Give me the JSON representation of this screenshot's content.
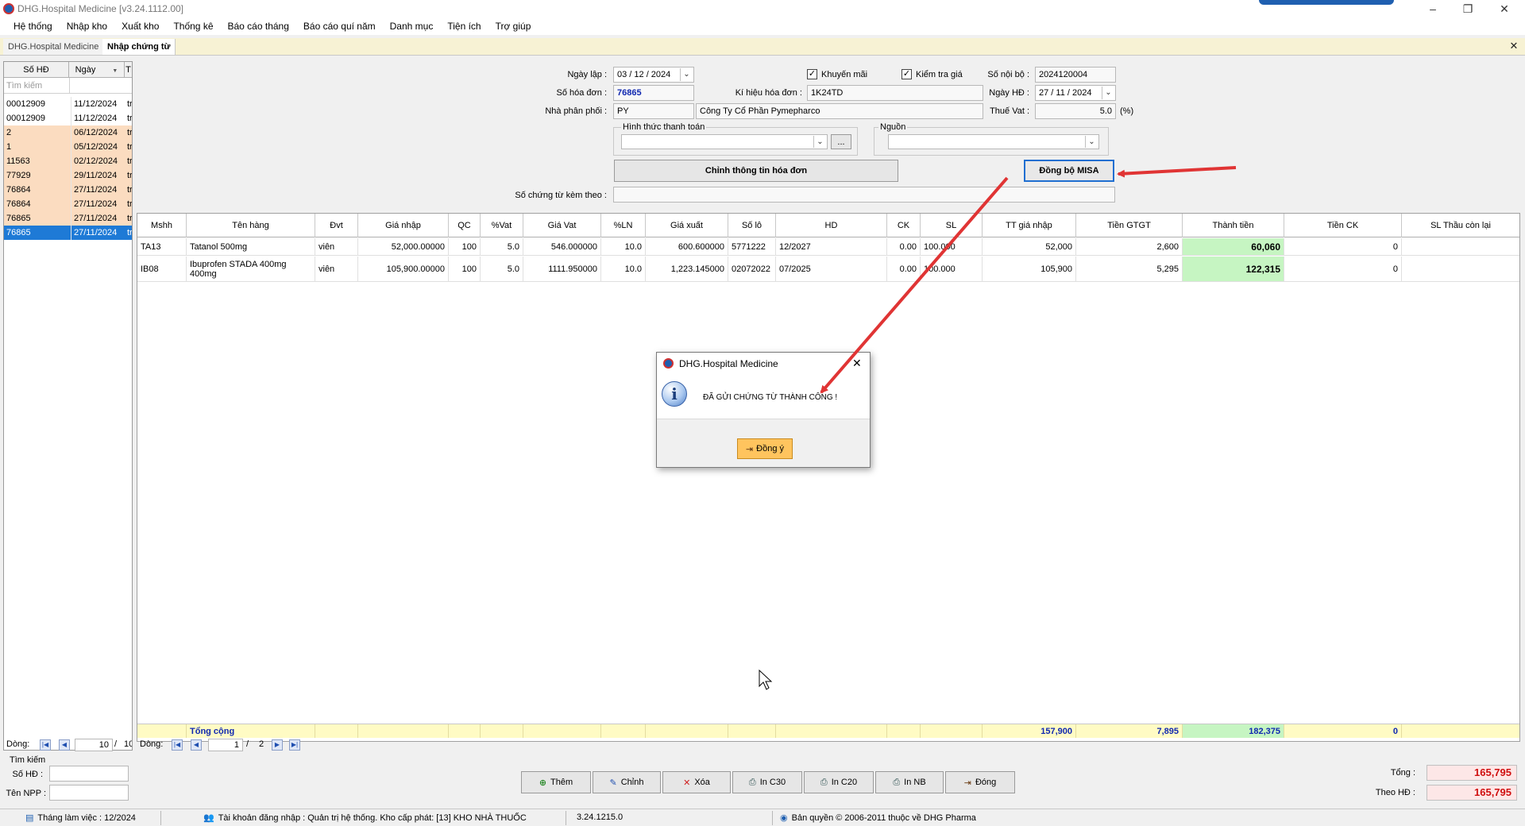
{
  "window": {
    "title": "DHG.Hospital Medicine [v3.24.1112.00]",
    "controls": [
      "–",
      "❐",
      "✕"
    ]
  },
  "menu": [
    "Hệ thống",
    "Nhập kho",
    "Xuất kho",
    "Thống kê",
    "Báo cáo tháng",
    "Báo cáo quí năm",
    "Danh mục",
    "Tiện ích",
    "Trợ giúp"
  ],
  "tabs": {
    "inactive": "DHG.Hospital Medicine",
    "active": "Nhập chứng từ",
    "close": "✕"
  },
  "left_list": {
    "headers": [
      "Số HĐ",
      "Ngày",
      "T"
    ],
    "search_placeholder": "Tìm kiếm",
    "rows": [
      {
        "so": "00012909",
        "ngay": "11/12/2024",
        "t": "tr",
        "style": "white"
      },
      {
        "so": "00012909",
        "ngay": "11/12/2024",
        "t": "tr",
        "style": "white"
      },
      {
        "so": "2",
        "ngay": "06/12/2024",
        "t": "tr",
        "style": "peach"
      },
      {
        "so": "1",
        "ngay": "05/12/2024",
        "t": "tr",
        "style": "peach"
      },
      {
        "so": "11563",
        "ngay": "02/12/2024",
        "t": "tr",
        "style": "peach"
      },
      {
        "so": "77929",
        "ngay": "29/11/2024",
        "t": "tr",
        "style": "peach"
      },
      {
        "so": "76864",
        "ngay": "27/11/2024",
        "t": "tr",
        "style": "peach"
      },
      {
        "so": "76864",
        "ngay": "27/11/2024",
        "t": "tr",
        "style": "peach"
      },
      {
        "so": "76865",
        "ngay": "27/11/2024",
        "t": "tr",
        "style": "peach"
      },
      {
        "so": "76865",
        "ngay": "27/11/2024",
        "t": "tr",
        "style": "sel"
      }
    ],
    "nav_label": "Dòng:",
    "nav_current": "10",
    "nav_sep": "/",
    "nav_total": "10"
  },
  "form": {
    "ngay_lap_label": "Ngày lập :",
    "ngay_lap_value": "03 / 12 / 2024",
    "so_hoa_don_label": "Số hóa đơn :",
    "so_hoa_don_value": "76865",
    "nha_phan_phoi_label": "Nhà phân phối :",
    "nha_phan_phoi_code": "PY",
    "nha_phan_phoi_name": "Công Ty Cổ Phần Pymepharco",
    "khuyen_mai_label": "Khuyến mãi",
    "khuyen_mai_checked": "✓",
    "kiem_tra_gia_label": "Kiểm tra giá",
    "kiem_tra_gia_checked": "✓",
    "ki_hieu_label": "Kí hiệu hóa đơn :",
    "ki_hieu_value": "1K24TD",
    "so_noi_bo_label": "Số nội bộ :",
    "so_noi_bo_value": "2024120004",
    "ngay_hd_label": "Ngày HĐ :",
    "ngay_hd_value": "27 / 11 / 2024",
    "thue_vat_label": "Thuế Vat :",
    "thue_vat_value": "5.0",
    "thue_vat_unit": "(%)",
    "hinh_thuc_label": "Hình thức thanh toán",
    "ellipsis": "...",
    "nguon_label": "Nguồn",
    "chinh_thong_tin_btn": "Chỉnh thông tin hóa đơn",
    "dong_bo_btn": "Đồng bộ MISA",
    "so_chung_tu_label": "Số chứng từ kèm theo :"
  },
  "grid": {
    "headers": [
      "Mshh",
      "Tên hàng",
      "Đvt",
      "Giá nhập",
      "QC",
      "%Vat",
      "Giá Vat",
      "%LN",
      "Giá xuất",
      "Số lô",
      "HD",
      "CK",
      "SL",
      "TT giá nhập",
      "Tiền GTGT",
      "Thành tiền",
      "Tiền CK",
      "SL Thầu còn lại"
    ],
    "rows": [
      [
        "TA13",
        "Tatanol 500mg",
        "viên",
        "52,000.00000",
        "100",
        "5.0",
        "546.000000",
        "10.0",
        "600.600000",
        "5771222",
        "12/2027",
        "0.00",
        "100.000",
        "52,000",
        "2,600",
        "60,060",
        "0",
        ""
      ],
      [
        "IB08",
        "Ibuprofen STADA 400mg 400mg",
        "viên",
        "105,900.00000",
        "100",
        "5.0",
        "1111.950000",
        "10.0",
        "1,223.145000",
        "02072022",
        "07/2025",
        "0.00",
        "100.000",
        "105,900",
        "5,295",
        "122,315",
        "0",
        ""
      ]
    ],
    "total_label": "Tổng cộng",
    "total_tt_gia_nhap": "157,900",
    "total_tien_gtgt": "7,895",
    "total_thanh_tien": "182,375",
    "total_tien_ck": "0",
    "nav_label": "Dòng:",
    "nav_current": "1",
    "nav_sep": "/",
    "nav_total": "2"
  },
  "search_panel": {
    "title": "Tìm kiếm",
    "so_hd_label": "Số HĐ :",
    "ten_npp_label": "Tên NPP :"
  },
  "actions": [
    "Thêm",
    "Chỉnh",
    "Xóa",
    "In C30",
    "In C20",
    "In NB",
    "Đóng"
  ],
  "totals": {
    "tong_label": "Tổng :",
    "tong_value": "165,795",
    "theo_hd_label": "Theo HĐ :",
    "theo_hd_value": "165,795"
  },
  "status": {
    "thang": "Tháng làm việc : 12/2024",
    "tai_khoan": "Tài khoản đăng nhập : Quản trị hệ thống. Kho cấp phát: [13] KHO NHÀ THUỐC",
    "version": "3.24.1215.0",
    "ban_quyen": "Bản quyền © 2006-2011 thuộc về DHG Pharma"
  },
  "dialog": {
    "title": "DHG.Hospital Medicine",
    "message": "ĐÃ GỬI CHỨNG TỪ THÀNH CÔNG !",
    "ok_label": "Đồng ý",
    "close": "✕",
    "info_glyph": "i"
  },
  "colors": {
    "annotation_arrow": "#e03434",
    "selected_row": "#1e7ad6",
    "peach_row": "#fbdcc0",
    "green_cell": "#c6f5c2",
    "total_row": "#fffbc4",
    "total_red": "#d01010"
  }
}
